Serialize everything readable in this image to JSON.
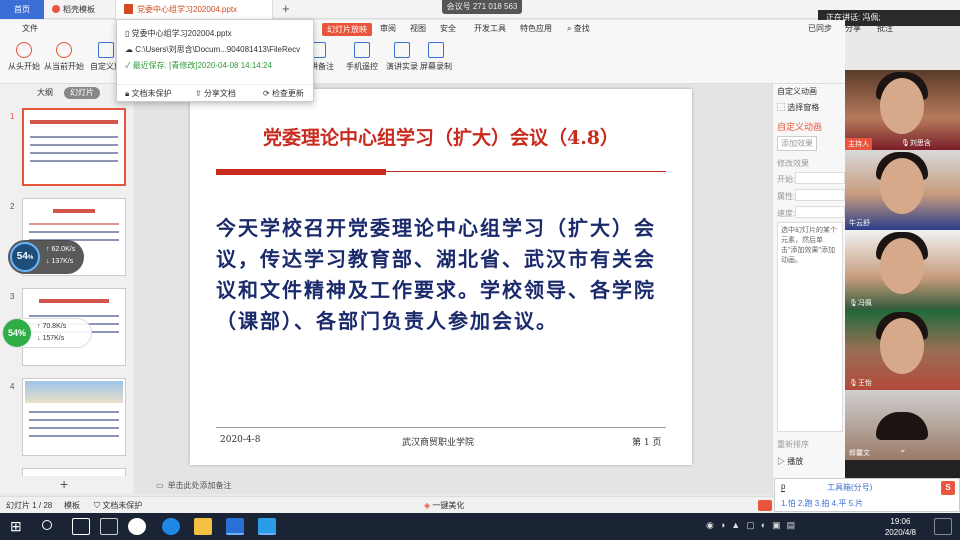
{
  "tabs": {
    "home": "首页",
    "template": "稻壳模板",
    "file": "党委中心组学习202004.pptx",
    "new_tab": "+"
  },
  "meeting_id": "会议号 271 018 563",
  "speaking": "正在讲话: 冯佩;",
  "menu": {
    "file": "文件",
    "slideshow": "幻灯片放映",
    "review": "审阅",
    "view": "视图",
    "security": "安全",
    "dev": "开发工具",
    "special": "特色应用",
    "search": "查找",
    "share": "分享",
    "comment": "批注",
    "saved": "已同步"
  },
  "ribbon": {
    "from_start": "从头开始",
    "from_current": "从当前开始",
    "custom_show": "自定义放",
    "notes": "演讲备注",
    "remote": "手机遥控",
    "rehearse": "演讲实录",
    "record": "屏幕录制"
  },
  "popup": {
    "filename": "党委中心组学习202004.pptx",
    "path": "C:\\Users\\刘思含\\Docum...904081413\\FileRecv",
    "saved": "最近保存: [青修改]2020-04-08 14:14:24",
    "protect": "文档未保护",
    "share": "分享文档",
    "check": "检查更新"
  },
  "left": {
    "outline": "大纲",
    "slides": "幻灯片",
    "numbers": [
      "1",
      "2",
      "3",
      "4"
    ],
    "add": "+"
  },
  "net1": {
    "percent": "54",
    "unit": "%",
    "up": "62.0K/s",
    "down": "137K/s"
  },
  "net2": {
    "percent": "54%",
    "up": "70.8K/s",
    "down": "157K/s"
  },
  "slide": {
    "title": "党委理论中心组学习（扩大）会议（4.8）",
    "body": "今天学校召开党委理论中心组学习（扩大）会议，传达学习教育部、湖北省、武汉市有关会议和文件精神及工作要求。学校领导、各学院（课部）、各部门负责人参加会议。",
    "date": "2020-4-8",
    "school": "武汉商贸职业学院",
    "page": "第 1 页"
  },
  "notes_placeholder": "单击此处添加备注",
  "taskpane": {
    "title": "自定义动画",
    "select_pane": "选择窗格",
    "custom_anim": "自定义动画",
    "add_effect": "添加效果",
    "remove": "删除",
    "modify": "修改效果",
    "start": "开始:",
    "property": "属性:",
    "speed": "速度:",
    "hint": "选中幻灯片的某个元素，然后单击\"添加效果\"添加动画。",
    "reorder": "重新排序",
    "play": "播放",
    "slideshow": "幻灯"
  },
  "video": {
    "host": "主持人",
    "p1": "刘思含",
    "p2": "牛云舒",
    "p3": "冯佩",
    "p4": "王怡",
    "p5": "郎馨文"
  },
  "status": {
    "slide_count": "幻灯片 1 / 28",
    "template": "模板",
    "protect": "文档未保护",
    "beautify": "一键美化"
  },
  "ime": {
    "input": "p",
    "toolbox": "工具箱(分号)",
    "candidates": "1.怕 2.跑 3.拍 4.平 5.片"
  },
  "clock": {
    "time": "19:06",
    "date": "2020/4/8"
  },
  "colors": {
    "accent": "#e8553c",
    "title_red": "#c82a1e",
    "body_navy": "#1b2a6b",
    "taskbar": "#1b2434"
  }
}
